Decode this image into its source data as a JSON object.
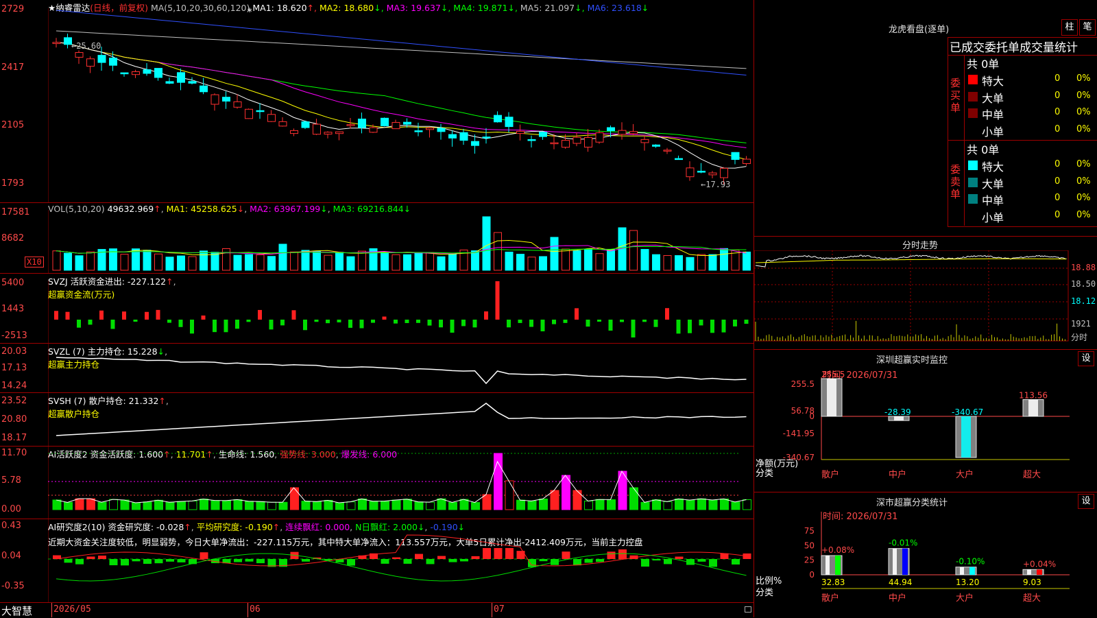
{
  "stock": {
    "name": "★纳睿雷达",
    "period": "(日线，前复权)",
    "ma_label": "MA(5,10,20,30,60,120)",
    "mas": [
      {
        "label": "MA1:",
        "value": "18.620",
        "arrow": "↑",
        "color": "#ffffff"
      },
      {
        "label": "MA2:",
        "value": "18.680",
        "arrow": "↓",
        "color": "#ffff00"
      },
      {
        "label": "MA3:",
        "value": "19.637",
        "arrow": "↓",
        "color": "#ff00ff"
      },
      {
        "label": "MA4:",
        "value": "19.871",
        "arrow": "↓",
        "color": "#00ff00"
      },
      {
        "label": "MA5:",
        "value": "21.097",
        "arrow": "↓",
        "color": "#c0c0c0"
      },
      {
        "label": "MA6:",
        "value": "23.618",
        "arrow": "↓",
        "color": "#3050ff"
      }
    ],
    "y_ticks": [
      "2729",
      "2417",
      "2105",
      "1793"
    ],
    "high_marker": "←25.60",
    "low_marker": "←17.93",
    "star": "*"
  },
  "vol": {
    "label": "VOL(5,10,20)",
    "value": "49632.969",
    "ma1": "MA1: 45258.625",
    "ma2": "MA2: 63967.199",
    "ma3": "MA3: 69216.844",
    "y_ticks": [
      "17581",
      "8682"
    ],
    "unit": "X10"
  },
  "svzj": {
    "line1": "SVZJ  活跃资金进出: -227.122",
    "line2": "超赢资金流(万元)",
    "y_ticks": [
      "5400",
      "1443",
      "-2513"
    ]
  },
  "svzl": {
    "line1": "SVZL (7) 主力持仓: 15.228",
    "line2": "超赢主力持仓",
    "y_ticks": [
      "20.03",
      "17.13",
      "14.24"
    ]
  },
  "svsh": {
    "line1": "SVSH (7) 散户持仓: 21.332",
    "line2": "超赢散户持仓",
    "y_ticks": [
      "23.52",
      "20.80",
      "18.17"
    ]
  },
  "ai_active": {
    "prefix": "AI活跃度2 资金活跃度: 1.600",
    "v2": "11.701",
    "v3": "生命线: 1.560",
    "v4": "强势线: 3.000",
    "v5": "爆发线: 6.000",
    "y_ticks": [
      "11.70",
      "5.78",
      "0.00"
    ]
  },
  "ai_research": {
    "prefix": "AI研究度2(10) 资金研究度: -0.028",
    "v2": "平均研究度: -0.190",
    "v3": "连续飘红: 0.000",
    "v4": "N日飘红: 2.000",
    "v5": "-0.190",
    "comment": "近期大资金关注度较低，明显弱势，今日大单净流出：-227.115万元，其中特大单净流入：113.557万元，大单5日累计净出-2412.409万元，当前主力控盘",
    "y_ticks": [
      "0.43",
      "0.04",
      "-0.35"
    ]
  },
  "footer": {
    "brand": "大智慧",
    "dates": [
      "2026/05",
      "06",
      "07"
    ]
  },
  "dragon": {
    "title": "龙虎看盘(逐单)",
    "btn1": "柱",
    "btn2": "笔",
    "subtitle": "已成交委托单成交量统计",
    "buy_side": "委买单",
    "sell_side": "委卖单",
    "buy_total": "共 0单",
    "sell_total": "共 0单",
    "rows": [
      {
        "name": "特大",
        "count": "0",
        "pct": "0%"
      },
      {
        "name": "大单",
        "count": "0",
        "pct": "0%"
      },
      {
        "name": "中单",
        "count": "0",
        "pct": "0%"
      },
      {
        "name": "小单",
        "count": "0",
        "pct": "0%"
      }
    ],
    "buy_colors": [
      "#ff0000",
      "#800000",
      "#800000",
      "#000000"
    ],
    "sell_colors": [
      "#00ffff",
      "#008080",
      "#008080",
      "#000000"
    ]
  },
  "minute": {
    "title": "分时走势",
    "y_labels": [
      "18.88",
      "18.50",
      "18.12",
      "1921",
      "分时"
    ]
  },
  "monitor": {
    "title": "深圳超赢实时监控",
    "setting": "设",
    "time": "时间: 2026/07/31",
    "y_ticks": [
      "255.5",
      "56.78",
      "0",
      "-141.95",
      "-340.67"
    ],
    "net_label": "净额(万元)",
    "cat_label": "分类",
    "categories": [
      "散户",
      "中户",
      "大户",
      "超大"
    ],
    "values": [
      255.5,
      -28.39,
      -340.67,
      113.56
    ],
    "value_labels": [
      "255.5",
      "-28.39",
      "-340.67",
      "113.56"
    ]
  },
  "classify": {
    "title": "深市超赢分类统计",
    "setting": "设",
    "time": "时间: 2026/07/31",
    "y_ticks": [
      "75",
      "50",
      "25",
      "0"
    ],
    "ratio_label": "比例%",
    "cat_label": "分类",
    "categories": [
      "散户",
      "中户",
      "大户",
      "超大"
    ],
    "values": [
      32.83,
      44.94,
      13.2,
      9.03
    ],
    "value_labels": [
      "32.83",
      "44.94",
      "13.20",
      "9.03"
    ],
    "changes": [
      "+0.08%",
      "-0.01%",
      "-0.10%",
      "+0.04%"
    ]
  }
}
